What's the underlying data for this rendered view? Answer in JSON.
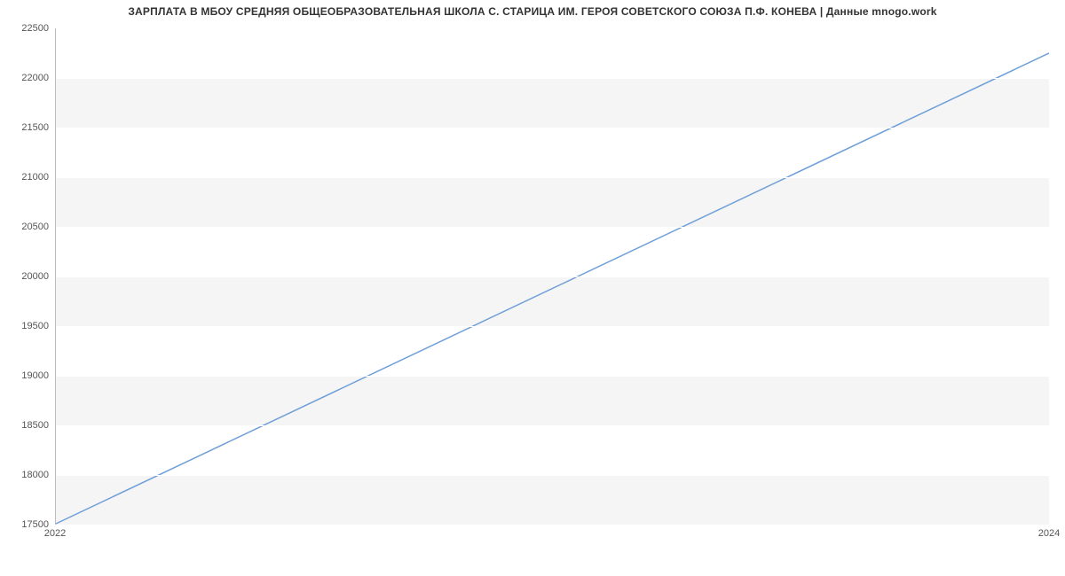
{
  "chart_data": {
    "type": "line",
    "title": "ЗАРПЛАТА В МБОУ СРЕДНЯЯ ОБЩЕОБРАЗОВАТЕЛЬНАЯ ШКОЛА С. СТАРИЦА ИМ. ГЕРОЯ СОВЕТСКОГО СОЮЗА П.Ф. КОНЕВА | Данные mnogo.work",
    "xlabel": "",
    "ylabel": "",
    "x": [
      2022,
      2024
    ],
    "values": [
      17500,
      22250
    ],
    "x_ticks": [
      2022,
      2024
    ],
    "y_ticks": [
      17500,
      18000,
      18500,
      19000,
      19500,
      20000,
      20500,
      21000,
      21500,
      22000,
      22500
    ],
    "xlim": [
      2022,
      2024
    ],
    "ylim": [
      17500,
      22500
    ],
    "line_color": "#6f9fd8",
    "grid": true
  }
}
